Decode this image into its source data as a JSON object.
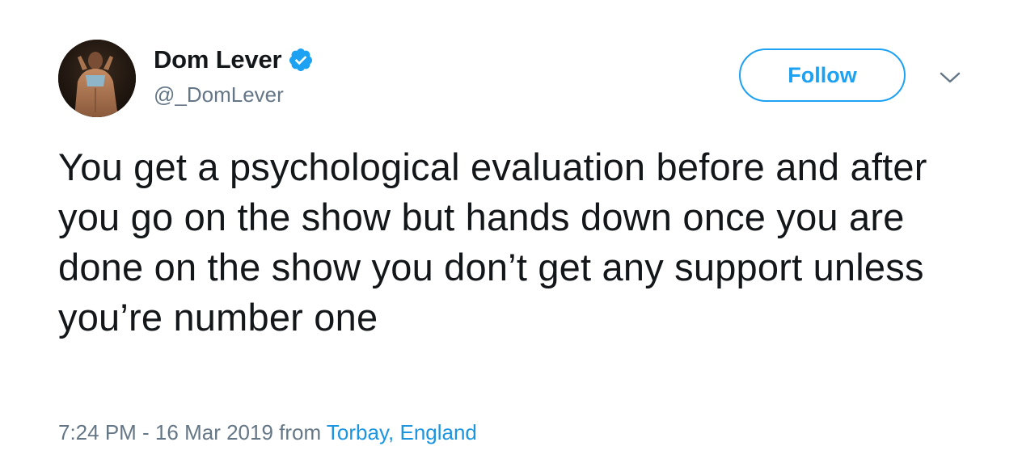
{
  "tweet": {
    "author": {
      "display_name": "Dom Lever",
      "handle": "@_DomLever",
      "verified": true,
      "avatar_icon": "profile-photo"
    },
    "follow_label": "Follow",
    "more_icon": "chevron-down-icon",
    "text": "You get a psychological evaluation before and after you go on the show but hands down once you are done on the show you don’t get any support unless you’re number one",
    "timestamp": "7:24 PM - 16 Mar 2019",
    "from_label": "from",
    "location": "Torbay, England"
  },
  "colors": {
    "brand_blue": "#1da1f2",
    "link_blue": "#1b95e0",
    "text_primary": "#14171a",
    "text_secondary": "#657786"
  }
}
